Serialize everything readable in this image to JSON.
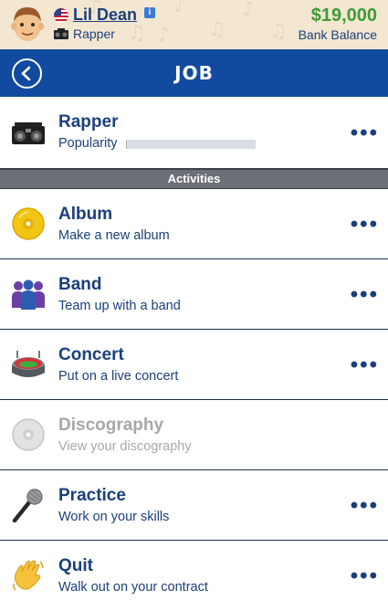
{
  "profile": {
    "name": "Lil Dean",
    "occupation": "Rapper",
    "bank_balance": "$19,000",
    "bank_label": "Bank Balance",
    "info_badge": "i"
  },
  "header": {
    "title": "JOB"
  },
  "job": {
    "title": "Rapper",
    "popularity_label": "Popularity",
    "popularity_level": 0.01
  },
  "section": {
    "label": "Activities"
  },
  "activities": [
    {
      "title": "Album",
      "subtitle": "Make a new album",
      "icon": "cd-icon",
      "enabled": true
    },
    {
      "title": "Band",
      "subtitle": "Team up with a band",
      "icon": "band-people-icon",
      "enabled": true
    },
    {
      "title": "Concert",
      "subtitle": "Put on a live concert",
      "icon": "stadium-icon",
      "enabled": true
    },
    {
      "title": "Discography",
      "subtitle": "View your discography",
      "icon": "disc-icon",
      "enabled": false
    },
    {
      "title": "Practice",
      "subtitle": "Work on your skills",
      "icon": "microphone-icon",
      "enabled": true
    },
    {
      "title": "Quit",
      "subtitle": "Walk out on your contract",
      "icon": "waving-hand-icon",
      "enabled": true
    }
  ],
  "more_label": "•••",
  "colors": {
    "header_bg": "#114a9e",
    "text_primary": "#1b3f7a",
    "money_green": "#3f9b35",
    "section_bg": "#6b6f78",
    "disabled_text": "#a7a7a7"
  }
}
